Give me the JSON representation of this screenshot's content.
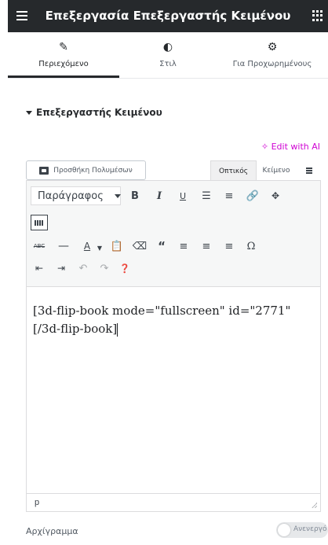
{
  "header": {
    "title": "Επεξεργασία Επεξεργαστής Κειμένου"
  },
  "tabs": [
    {
      "label": "Περιεχόμενο",
      "icon": "pencil-icon",
      "active": true
    },
    {
      "label": "Στιλ",
      "icon": "contrast-icon",
      "active": false
    },
    {
      "label": "Για Προχωρημένους",
      "icon": "gear-icon",
      "active": false
    }
  ],
  "section": {
    "title": "Επεξεργαστής Κειμένου"
  },
  "edit_ai": {
    "label": "Edit with AI",
    "color": "#d004d4"
  },
  "editor": {
    "add_media_label": "Προσθήκη Πολυμέσων",
    "mode_visual": "Οπτικός",
    "mode_text": "Κείμενο",
    "format_select": "Παράγραφος",
    "content_line1": "[3d-flip-book mode=\"fullscreen\" id=\"2771\"",
    "content_line2": "[/3d-flip-book]",
    "status_path": "p"
  },
  "bottom": {
    "label": "Αρχίγραμμα",
    "toggle_label": "Ανενεργό"
  }
}
